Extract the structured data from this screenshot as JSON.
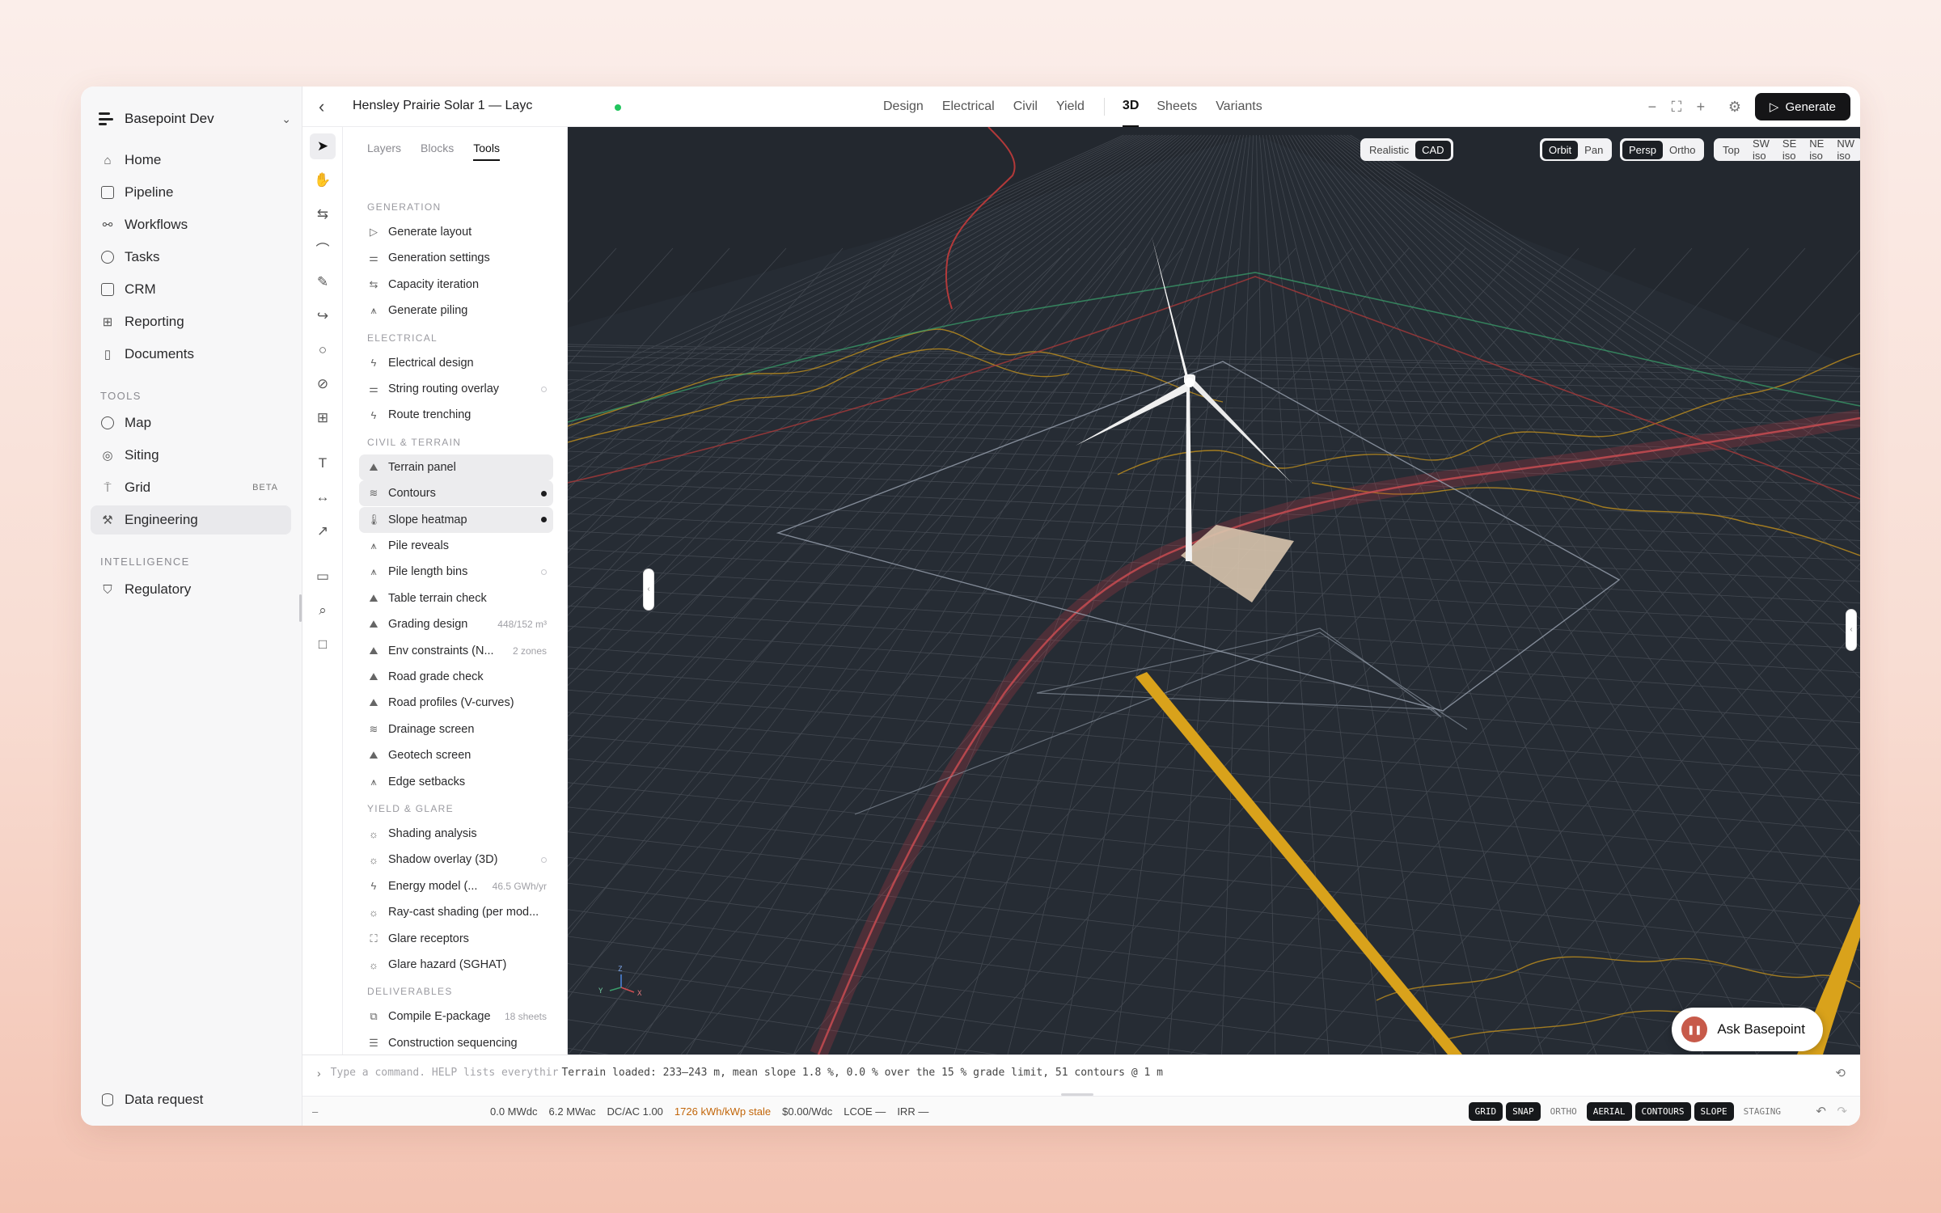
{
  "org": {
    "name": "Basepoint Dev"
  },
  "nav": {
    "main": [
      {
        "label": "Home",
        "icon": "home-icon"
      },
      {
        "label": "Pipeline",
        "icon": "briefcase-icon"
      },
      {
        "label": "Workflows",
        "icon": "workflow-icon"
      },
      {
        "label": "Tasks",
        "icon": "check-circle-icon"
      },
      {
        "label": "CRM",
        "icon": "contact-icon"
      },
      {
        "label": "Reporting",
        "icon": "grid-icon"
      },
      {
        "label": "Documents",
        "icon": "document-icon"
      }
    ],
    "tools_label": "TOOLS",
    "tools": [
      {
        "label": "Map",
        "icon": "globe-icon"
      },
      {
        "label": "Siting",
        "icon": "crosshair-icon"
      },
      {
        "label": "Grid",
        "icon": "transmission-tower-icon",
        "badge": "BETA"
      },
      {
        "label": "Engineering",
        "icon": "engineering-icon",
        "active": true
      }
    ],
    "intelligence_label": "INTELLIGENCE",
    "intelligence": [
      {
        "label": "Regulatory",
        "icon": "shield-check-icon"
      }
    ],
    "footer": {
      "label": "Data request",
      "icon": "database-icon"
    }
  },
  "header": {
    "project_title": "Hensley Prairie Solar 1 — Layc",
    "tabs": [
      "Design",
      "Electrical",
      "Civil",
      "Yield",
      "3D",
      "Sheets",
      "Variants"
    ],
    "active_tab": "3D",
    "generate_label": "Generate"
  },
  "panel": {
    "tabs": [
      "Layers",
      "Blocks",
      "Tools"
    ],
    "active_tab": "Tools",
    "sections": [
      {
        "label": "GENERATION",
        "items": [
          {
            "label": "Generate layout",
            "icon": "play-icon"
          },
          {
            "label": "Generation settings",
            "icon": "sliders-icon"
          },
          {
            "label": "Capacity iteration",
            "icon": "arrows-icon"
          },
          {
            "label": "Generate piling",
            "icon": "pile-icon"
          }
        ]
      },
      {
        "label": "ELECTRICAL",
        "items": [
          {
            "label": "Electrical design",
            "icon": "bolt-icon"
          },
          {
            "label": "String routing overlay",
            "icon": "route-icon",
            "toggle": "off"
          },
          {
            "label": "Route trenching",
            "icon": "bolt-icon"
          }
        ]
      },
      {
        "label": "CIVIL & TERRAIN",
        "items": [
          {
            "label": "Terrain panel",
            "icon": "mountain-icon",
            "selected": true
          },
          {
            "label": "Contours",
            "icon": "contour-icon",
            "selected": true,
            "toggle": "on"
          },
          {
            "label": "Slope heatmap",
            "icon": "thermometer-icon",
            "selected": true,
            "toggle": "on"
          },
          {
            "label": "Pile reveals",
            "icon": "pile-icon"
          },
          {
            "label": "Pile length bins",
            "icon": "pile-icon",
            "toggle": "off"
          },
          {
            "label": "Table terrain check",
            "icon": "mountain-icon"
          },
          {
            "label": "Grading design",
            "icon": "mountain-icon",
            "meta": "448/152 m³"
          },
          {
            "label": "Env constraints (N...",
            "icon": "mountain-icon",
            "meta": "2 zones"
          },
          {
            "label": "Road grade check",
            "icon": "mountain-icon"
          },
          {
            "label": "Road profiles (V-curves)",
            "icon": "mountain-icon"
          },
          {
            "label": "Drainage screen",
            "icon": "contour-icon"
          },
          {
            "label": "Geotech screen",
            "icon": "mountain-icon"
          },
          {
            "label": "Edge setbacks",
            "icon": "pile-icon"
          }
        ]
      },
      {
        "label": "YIELD & GLARE",
        "items": [
          {
            "label": "Shading analysis",
            "icon": "sun-icon"
          },
          {
            "label": "Shadow overlay (3D)",
            "icon": "sun-icon",
            "toggle": "off"
          },
          {
            "label": "Energy model (...",
            "icon": "bolt-icon",
            "meta": "46.5 GWh/yr"
          },
          {
            "label": "Ray-cast shading (per mod...",
            "icon": "sun-icon"
          },
          {
            "label": "Glare receptors",
            "icon": "target-icon"
          },
          {
            "label": "Glare hazard (SGHAT)",
            "icon": "sun-icon"
          }
        ]
      },
      {
        "label": "DELIVERABLES",
        "items": [
          {
            "label": "Compile E-package",
            "icon": "package-icon",
            "meta": "18 sheets"
          },
          {
            "label": "Construction sequencing",
            "icon": "stack-icon"
          }
        ]
      }
    ]
  },
  "viewport": {
    "render_mode": [
      "Realistic",
      "CAD"
    ],
    "render_mode_active": "CAD",
    "nav_mode": [
      "Orbit",
      "Pan"
    ],
    "nav_mode_active": "Orbit",
    "projection": [
      "Persp",
      "Ortho"
    ],
    "projection_active": "Persp",
    "views": [
      "Top",
      "SW iso",
      "SE iso",
      "NE iso",
      "NW iso"
    ],
    "axis_labels": [
      "Z",
      "Y",
      "X"
    ],
    "colors": {
      "background": "#23282f",
      "road": "#d9a21b",
      "boundary_red": "#c23b3b",
      "contour": "#b88a1e",
      "grid": "#5a5f68"
    }
  },
  "ask": {
    "label": "Ask Basepoint"
  },
  "command": {
    "placeholder": "Type a command. HELP lists everythir",
    "message": "Terrain loaded: 233–243 m, mean slope 1.8 %, 0.0 % over the 15 % grade limit, 51 contours @ 1 m"
  },
  "status": {
    "lead": "–",
    "metrics": [
      "0.0 MWdc",
      "6.2 MWac",
      "DC/AC 1.00"
    ],
    "warning": "1726 kWh/kWp stale",
    "metrics2": [
      "$0.00/Wdc",
      "LCOE —",
      "IRR —"
    ],
    "toggles": [
      {
        "label": "GRID",
        "on": true
      },
      {
        "label": "SNAP",
        "on": true
      },
      {
        "label": "ORTHO",
        "on": false
      },
      {
        "label": "AERIAL",
        "on": true
      },
      {
        "label": "CONTOURS",
        "on": true
      },
      {
        "label": "SLOPE",
        "on": true
      },
      {
        "label": "STAGING",
        "on": false
      }
    ]
  }
}
